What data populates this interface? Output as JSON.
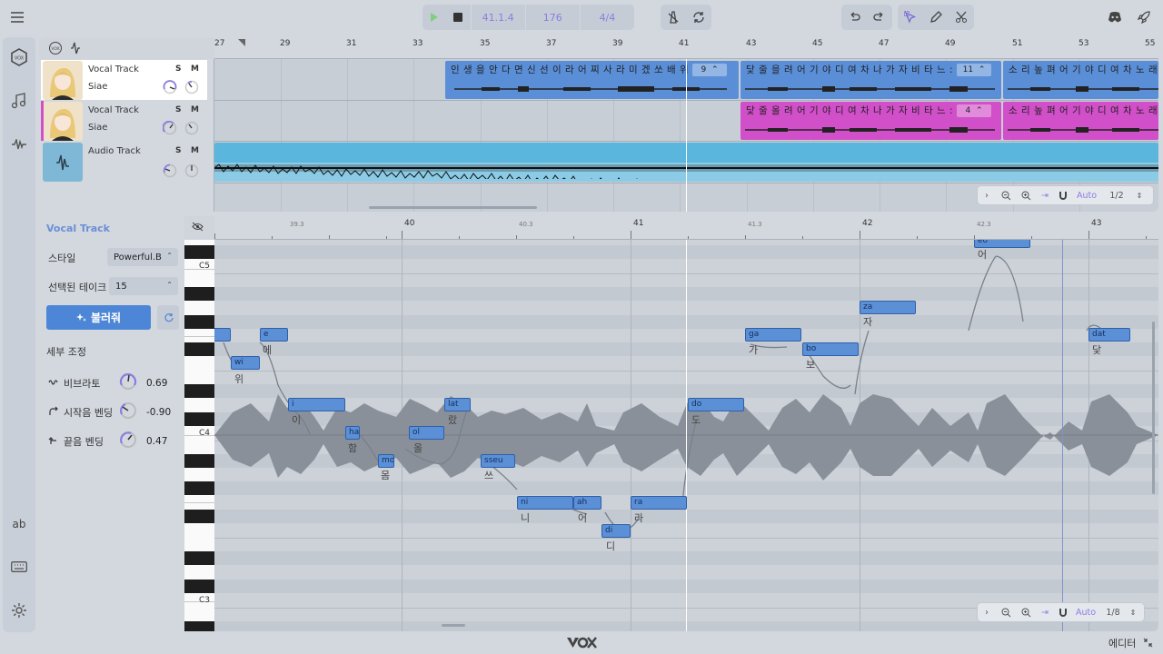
{
  "app": {
    "name": "VOX"
  },
  "transport": {
    "position": "41.1.4",
    "tempo": "176",
    "time_signature": "4/4"
  },
  "sidebar": {
    "text_tool_label": "ab"
  },
  "tracks": [
    {
      "name": "Vocal Track",
      "singer": "Siae",
      "solo": "S",
      "mute": "M"
    },
    {
      "name": "Vocal Track",
      "singer": "Siae",
      "solo": "S",
      "mute": "M"
    },
    {
      "name": "Audio Track",
      "solo": "S",
      "mute": "M"
    }
  ],
  "arrangement": {
    "bar_numbers": [
      "27",
      "29",
      "31",
      "33",
      "35",
      "37",
      "39",
      "41",
      "43",
      "45",
      "47",
      "49",
      "51",
      "53",
      "55"
    ],
    "clips": {
      "track1_a_lyrics": "인 생 을 안 다 면 신 선 이 라 어 찌 사 라 미 겠 쏘 배 위",
      "track1_a_take": "9",
      "track1_b_lyrics": "닻 줄 을 려 어 기 야 디 여 차 나 가 자 비 타 느 :",
      "track1_b_take": "11",
      "track1_c_lyrics": "소 리 높 펴 어 기 야 디 여 차 노 래",
      "track2_a_lyrics": "닻 줄 올 려 어 기 야 디 여 차 나 가 자 비 타 느 :",
      "track2_a_take": "4",
      "track2_b_lyrics": "소 리 높 펴 어 기 야 디 여 차 노 래"
    },
    "zoom": {
      "mode": "Auto",
      "page": "1/2"
    }
  },
  "piano_roll": {
    "title": "Vocal Track",
    "style_label": "스타일",
    "style_value": "Powerful.B",
    "take_label": "선택된 테이크",
    "take_value": "15",
    "generate_button": "불러줘",
    "fine_tune_label": "세부 조정",
    "vibrato_label": "비브라토",
    "vibrato_value": "0.69",
    "start_bend_label": "시작음 벤딩",
    "start_bend_value": "-0.90",
    "end_bend_label": "끝음 벤딩",
    "end_bend_value": "0.47",
    "key_labels": {
      "c5": "C5",
      "c4": "C4",
      "c3": "C3"
    },
    "ruler": {
      "m1": "39.3",
      "m2": "40",
      "m3": "40.3",
      "m4": "41",
      "m5": "41.3",
      "m6": "42",
      "m7": "42.3",
      "m8": "43"
    },
    "notes": [
      {
        "syl": "",
        "lyric": ""
      },
      {
        "syl": "wi",
        "lyric": "위"
      },
      {
        "syl": "e",
        "lyric": "에"
      },
      {
        "syl": "i",
        "lyric": "이"
      },
      {
        "syl": "ha",
        "lyric": "함"
      },
      {
        "syl": "mo",
        "lyric": "몸"
      },
      {
        "syl": "ol",
        "lyric": "올"
      },
      {
        "syl": "lat",
        "lyric": "랐"
      },
      {
        "syl": "sseu",
        "lyric": "쓰"
      },
      {
        "syl": "ni",
        "lyric": "니"
      },
      {
        "syl": "ah",
        "lyric": "어"
      },
      {
        "syl": "di",
        "lyric": "디"
      },
      {
        "syl": "ra",
        "lyric": "라"
      },
      {
        "syl": "do",
        "lyric": "도"
      },
      {
        "syl": "ga",
        "lyric": "가"
      },
      {
        "syl": "bo",
        "lyric": "보"
      },
      {
        "syl": "za",
        "lyric": "자"
      },
      {
        "syl": "eo",
        "lyric": "어"
      },
      {
        "syl": "dat",
        "lyric": "닻"
      }
    ],
    "zoom": {
      "mode": "Auto",
      "page": "1/8"
    }
  },
  "footer": {
    "mode_label": "에디터"
  },
  "colors": {
    "accent": "#8f7be0",
    "clip_blue": "#5a8fd8",
    "clip_magenta": "#d14fc8",
    "audio_cyan": "#5bb6dd",
    "note": "#5b8fd6"
  }
}
